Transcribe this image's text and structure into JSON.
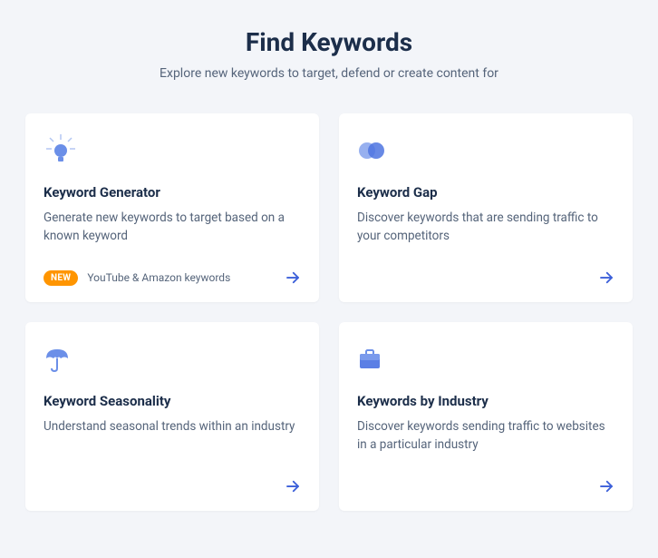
{
  "page": {
    "title": "Find Keywords",
    "subtitle": "Explore new keywords to target, defend or create content for"
  },
  "cards": [
    {
      "title": "Keyword Generator",
      "description": "Generate new keywords to target based on a known keyword",
      "badge_label": "NEW",
      "badge_text": "YouTube & Amazon keywords"
    },
    {
      "title": "Keyword Gap",
      "description": "Discover keywords that are sending traffic to your competitors"
    },
    {
      "title": "Keyword Seasonality",
      "description": "Understand seasonal trends within an industry"
    },
    {
      "title": "Keywords by Industry",
      "description": "Discover keywords sending traffic to websites in a particular industry"
    }
  ]
}
